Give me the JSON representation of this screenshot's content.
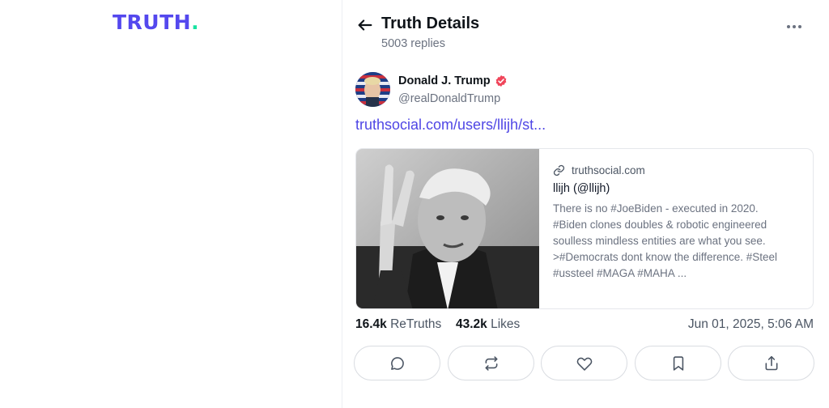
{
  "brand": {
    "logo_text": "TRUTH",
    "logo_dot": ".",
    "color": "#5448ee",
    "dot_color": "#17e3a1"
  },
  "header": {
    "title": "Truth Details",
    "replies": "5003 replies",
    "back_icon": "arrow-left-icon",
    "more_icon": "more-horizontal-icon"
  },
  "post": {
    "author_name": "Donald J. Trump",
    "author_handle": "@realDonaldTrump",
    "verified": true,
    "link_text": "truthsocial.com/users/llijh/st...",
    "card": {
      "domain": "truthsocial.com",
      "title": "llijh (@llijh)",
      "description": "There is no #JoeBiden - executed in 2020. #Biden clones doubles & robotic engineered soulless mindless entities are what you see. >#Democrats dont know the difference. #Steel #ussteel #MAGA #MAHA ..."
    },
    "stats": {
      "retruths_count": "16.4k",
      "retruths_label": "ReTruths",
      "likes_count": "43.2k",
      "likes_label": "Likes",
      "timestamp": "Jun 01, 2025, 5:06 AM"
    },
    "actions": [
      "reply-icon",
      "retruth-icon",
      "like-icon",
      "bookmark-icon",
      "share-icon"
    ]
  },
  "colors": {
    "link": "#4f46e5",
    "verified": "#f0455a"
  }
}
